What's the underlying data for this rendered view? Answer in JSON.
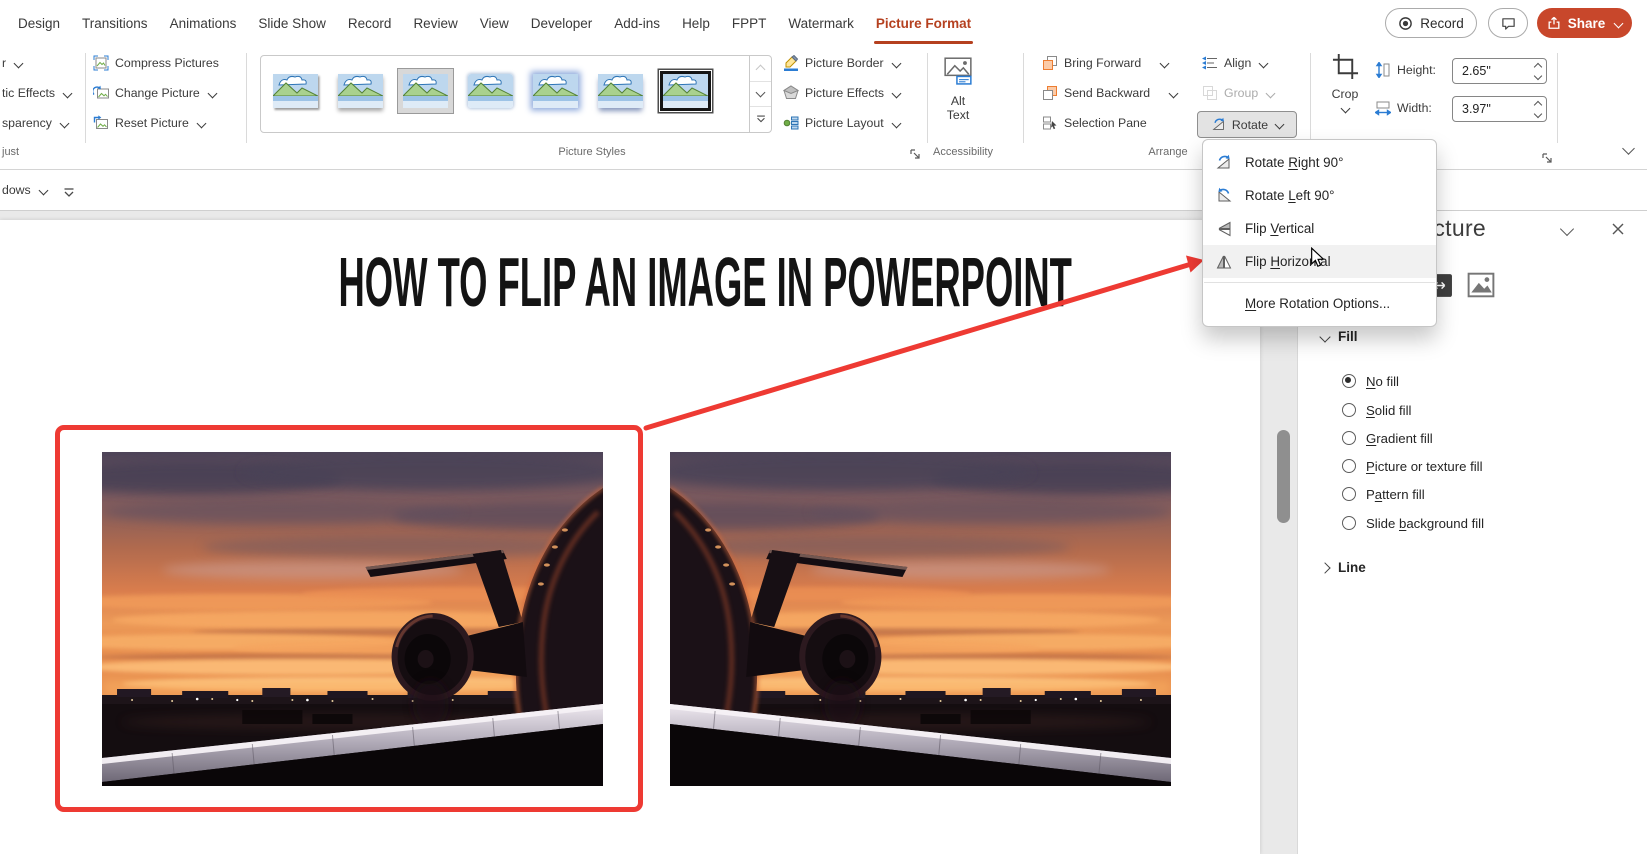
{
  "colors": {
    "accent_red": "#B5401F",
    "share_red": "#C8472B",
    "annotation_red": "#EE3A33",
    "icon_blue": "#2B7CD3",
    "icon_orange": "#ED7D31",
    "menu_hover": "#f1f1f1"
  },
  "menubar": {
    "tabs": [
      {
        "label": "Design"
      },
      {
        "label": "Transitions"
      },
      {
        "label": "Animations"
      },
      {
        "label": "Slide Show"
      },
      {
        "label": "Record"
      },
      {
        "label": "Review"
      },
      {
        "label": "View"
      },
      {
        "label": "Developer"
      },
      {
        "label": "Add-ins"
      },
      {
        "label": "Help"
      },
      {
        "label": "FPPT"
      },
      {
        "label": "Watermark"
      },
      {
        "label": "Picture Format",
        "active": true
      }
    ],
    "record_button_label": "Record",
    "share_button_label": "Share"
  },
  "ribbon": {
    "cut_group": {
      "items": [
        {
          "label": "r"
        },
        {
          "label": "tic Effects"
        },
        {
          "label": "sparency"
        }
      ],
      "group_label": "just"
    },
    "adjust_buttons": [
      {
        "label": "Compress Pictures",
        "icon": "compress-pictures-icon",
        "dropdown": false
      },
      {
        "label": "Change Picture",
        "icon": "change-picture-icon",
        "dropdown": true
      },
      {
        "label": "Reset Picture",
        "icon": "reset-picture-icon",
        "dropdown": true
      }
    ],
    "picture_styles": {
      "group_label": "Picture Styles",
      "styles": [
        {
          "name": "style-drop-shadow"
        },
        {
          "name": "style-soft-shadow"
        },
        {
          "name": "style-applied",
          "state": "applied"
        },
        {
          "name": "style-soft-edge"
        },
        {
          "name": "style-glow-edge"
        },
        {
          "name": "style-reflection"
        },
        {
          "name": "style-black-frame",
          "state": "highlighted"
        }
      ]
    },
    "style_buttons": [
      {
        "label": "Picture Border",
        "icon": "picture-border-icon",
        "dropdown": true
      },
      {
        "label": "Picture Effects",
        "icon": "picture-effects-icon",
        "dropdown": true
      },
      {
        "label": "Picture Layout",
        "icon": "picture-layout-icon",
        "dropdown": true
      }
    ],
    "accessibility": {
      "alt_text_line1": "Alt",
      "alt_text_line2": "Text",
      "group_label": "Accessibility"
    },
    "arrange": {
      "left_buttons": [
        {
          "label": "Bring Forward",
          "icon": "bring-forward-icon",
          "dropdown": true
        },
        {
          "label": "Send Backward",
          "icon": "send-backward-icon",
          "dropdown": true
        },
        {
          "label": "Selection Pane",
          "icon": "selection-pane-icon",
          "dropdown": false
        }
      ],
      "right_buttons": [
        {
          "label": "Align",
          "icon": "align-icon",
          "dropdown": true
        },
        {
          "label": "Group",
          "icon": "group-icon",
          "dropdown": true,
          "disabled": true
        },
        {
          "label": "Rotate",
          "icon": "rotate-small-icon",
          "dropdown": true,
          "pressed": true
        }
      ],
      "group_label": "Arrange"
    },
    "size": {
      "crop_label": "Crop",
      "height_label": "Height:",
      "height_value": "2.65\"",
      "width_label": "Width:",
      "width_value": "3.97\""
    }
  },
  "qat": {
    "cut_label": "dows"
  },
  "rotate_menu": {
    "items": [
      {
        "label": "Rotate Right 90°",
        "uidx": 7,
        "icon": "rotate-right-icon"
      },
      {
        "label": "Rotate Left 90°",
        "uidx": 7,
        "icon": "rotate-left-icon"
      },
      {
        "label": "Flip Vertical",
        "uidx": 5,
        "icon": "flip-vertical-icon"
      },
      {
        "label": "Flip Horizontal",
        "uidx": 5,
        "icon": "flip-horizontal-icon",
        "hovered": true
      },
      {
        "label": "More Rotation Options...",
        "uidx": 0,
        "icon": null,
        "separator_before": true
      }
    ]
  },
  "slide": {
    "title": "HOW TO FLIP AN IMAGE IN POWERPOINT",
    "images": [
      {
        "name": "airplane-sunset-photo",
        "flipped": false,
        "annotated": true
      },
      {
        "name": "airplane-sunset-photo-flipped",
        "flipped": true,
        "annotated": false
      }
    ]
  },
  "pane": {
    "title": "Format Picture",
    "fill_section": {
      "label": "Fill",
      "options": [
        {
          "label": "No fill",
          "uidx": 0,
          "selected": true
        },
        {
          "label": "Solid fill",
          "uidx": 0
        },
        {
          "label": "Gradient fill",
          "uidx": 0
        },
        {
          "label": "Picture or texture fill",
          "uidx": 0
        },
        {
          "label": "Pattern fill",
          "uidx": 1
        },
        {
          "label": "Slide background fill",
          "uidx": 6
        }
      ]
    },
    "line_section": {
      "label": "Line"
    }
  }
}
